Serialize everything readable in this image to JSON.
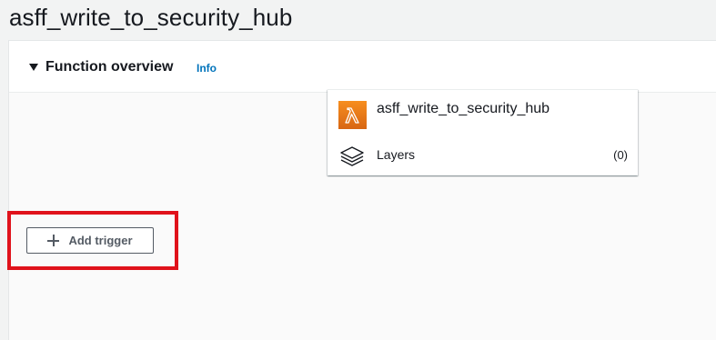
{
  "page": {
    "title": "asff_write_to_security_hub"
  },
  "function_overview": {
    "title": "Function overview",
    "info_label": "Info",
    "function_card": {
      "function_name": "asff_write_to_security_hub",
      "icon": "lambda-icon",
      "layers_label": "Layers",
      "layers_count": "(0)",
      "layers_icon": "layers-icon"
    },
    "add_trigger_label": "Add trigger",
    "add_trigger_icon": "plus-icon"
  },
  "colors": {
    "link": "#0073bb",
    "lambda_orange": "#f78e1e",
    "highlight": "#e0121b"
  }
}
